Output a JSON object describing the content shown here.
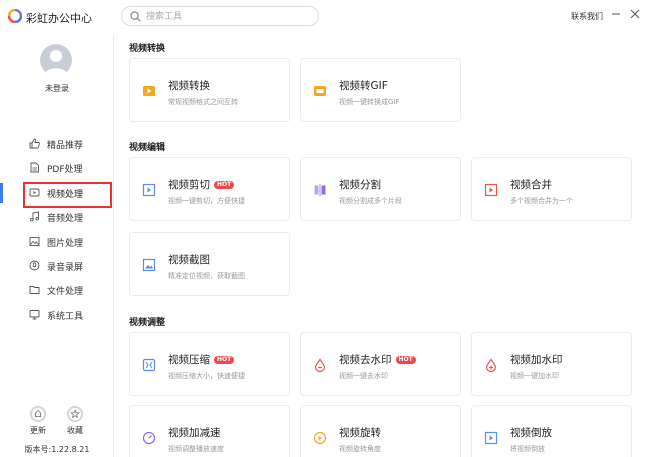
{
  "app": {
    "title": "彩虹办公中心",
    "contact": "联系我们"
  },
  "search": {
    "placeholder": "搜索工具"
  },
  "user": {
    "status": "未登录"
  },
  "nav": [
    {
      "label": "精品推荐",
      "icon": "thumbs-up-icon"
    },
    {
      "label": "PDF处理",
      "icon": "pdf-file-icon"
    },
    {
      "label": "视频处理",
      "icon": "video-icon",
      "active": true
    },
    {
      "label": "音频处理",
      "icon": "music-note-icon"
    },
    {
      "label": "图片处理",
      "icon": "image-icon"
    },
    {
      "label": "录音录屏",
      "icon": "record-icon"
    },
    {
      "label": "文件处理",
      "icon": "folder-icon"
    },
    {
      "label": "系统工具",
      "icon": "monitor-icon"
    }
  ],
  "tools": {
    "update_label": "更新",
    "favorite_label": "收藏"
  },
  "version": "版本号:1.22.8.21",
  "sections": [
    {
      "title": "视频转换",
      "cards": [
        {
          "title": "视频转换",
          "desc": "常规视频格式之间互转",
          "hot": false,
          "color": "#f5a623"
        },
        {
          "title": "视频转GIF",
          "desc": "视频一键转换成GIF",
          "hot": false,
          "color": "#f5a623"
        }
      ]
    },
    {
      "title": "视频编辑",
      "cards": [
        {
          "title": "视频剪切",
          "desc": "视频一键剪切，方便快捷",
          "hot": true,
          "color": "#5b8def"
        },
        {
          "title": "视频分割",
          "desc": "视频分割成多个片段",
          "hot": false,
          "color": "#8e6be8"
        },
        {
          "title": "视频合并",
          "desc": "多个视频合并为一个",
          "hot": false,
          "color": "#ef5350"
        },
        {
          "title": "视频截图",
          "desc": "精准定位视频，获取截图",
          "hot": false,
          "color": "#5b8def"
        }
      ]
    },
    {
      "title": "视频调整",
      "cards": [
        {
          "title": "视频压缩",
          "desc": "视频压缩大小，快速便捷",
          "hot": true,
          "color": "#5b8def"
        },
        {
          "title": "视频去水印",
          "desc": "视频一键去水印",
          "hot": true,
          "color": "#ef5350"
        },
        {
          "title": "视频加水印",
          "desc": "视频一键加水印",
          "hot": false,
          "color": "#ef5350"
        },
        {
          "title": "视频加减速",
          "desc": "视频调整播放速度",
          "hot": false,
          "color": "#8e6be8"
        },
        {
          "title": "视频旋转",
          "desc": "视频旋转角度",
          "hot": false,
          "color": "#f5a623"
        },
        {
          "title": "视频倒放",
          "desc": "将视频倒放",
          "hot": false,
          "color": "#5b8def"
        }
      ]
    }
  ],
  "hot_label": "HOT"
}
